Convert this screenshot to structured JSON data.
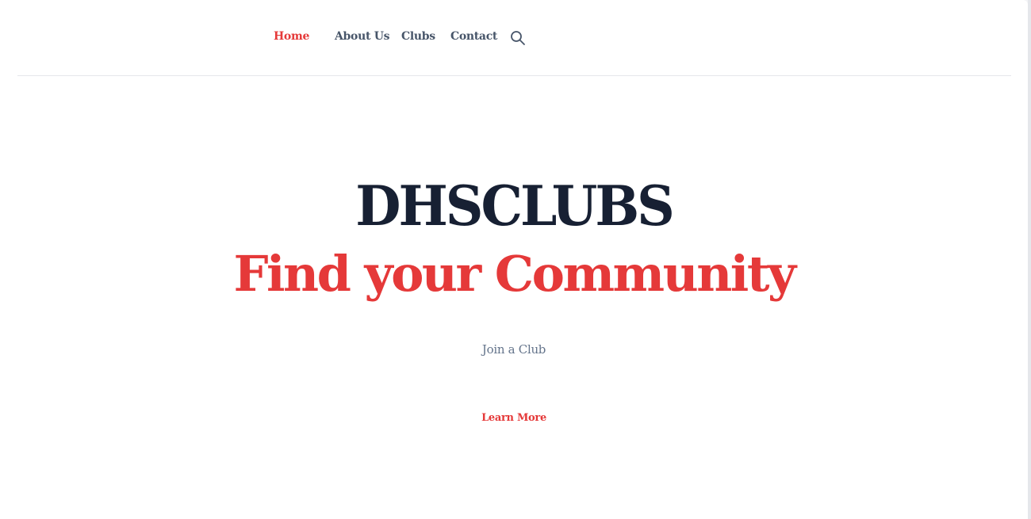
{
  "nav": {
    "items": [
      {
        "label": "Home",
        "active": true
      },
      {
        "label": "About Us",
        "active": false
      },
      {
        "label": "Clubs",
        "active": false
      },
      {
        "label": "Contact",
        "active": false
      }
    ],
    "search_icon": "search-icon"
  },
  "hero": {
    "title": "DHSCLUBS",
    "subtitle": "Find your Community",
    "tagline": "Join a Club",
    "cta_label": "Learn More"
  },
  "colors": {
    "accent": "#e53939",
    "title": "#172033",
    "nav_text": "#475569",
    "muted_text": "#64748b",
    "divider": "#e5e7eb",
    "background": "#ffffff"
  }
}
